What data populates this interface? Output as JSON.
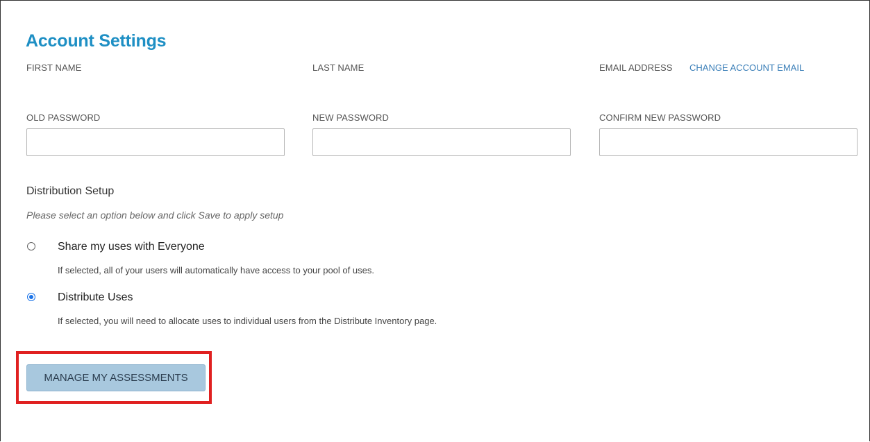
{
  "page": {
    "title": "Account Settings"
  },
  "account": {
    "first_name_label": "FIRST NAME",
    "last_name_label": "LAST NAME",
    "email_label": "EMAIL ADDRESS",
    "change_email_link": "CHANGE ACCOUNT EMAIL"
  },
  "password": {
    "old_label": "OLD PASSWORD",
    "new_label": "NEW PASSWORD",
    "confirm_label": "CONFIRM NEW PASSWORD",
    "old_value": "",
    "new_value": "",
    "confirm_value": ""
  },
  "distribution": {
    "title": "Distribution Setup",
    "hint": "Please select an option below and click Save to apply setup",
    "options": [
      {
        "label": "Share my uses with Everyone",
        "description": "If selected, all of your users will automatically have access to your pool of uses.",
        "selected": false
      },
      {
        "label": "Distribute Uses",
        "description": "If selected, you will need to allocate uses to individual users from the Distribute Inventory page.",
        "selected": true
      }
    ]
  },
  "actions": {
    "manage_button": "MANAGE MY ASSESSMENTS"
  },
  "colors": {
    "title": "#1e8fc4",
    "link": "#3b7fb8",
    "button_bg": "#a8c8de",
    "highlight": "#e02020",
    "radio_selected": "#1a73e8"
  }
}
